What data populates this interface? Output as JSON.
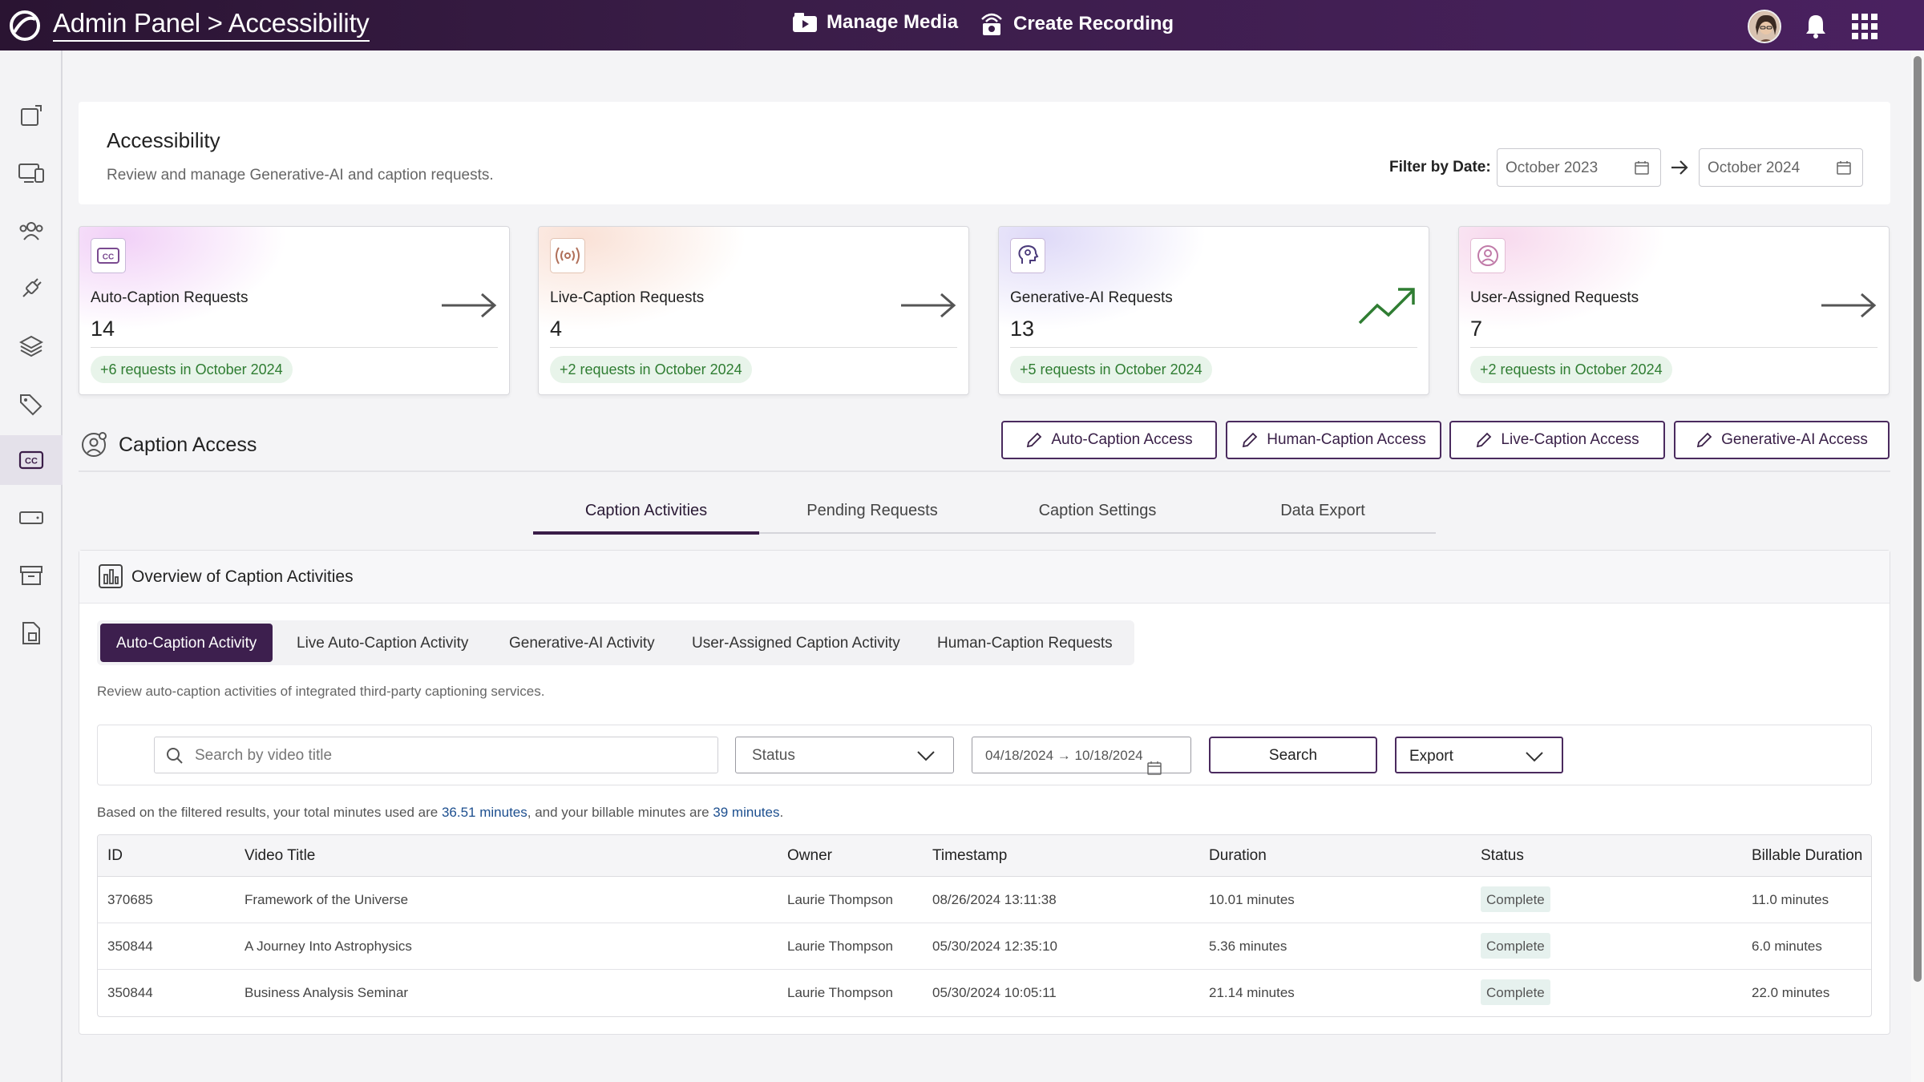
{
  "header": {
    "breadcrumb": "Admin Panel > Accessibility",
    "nav": [
      {
        "label": "Manage Media",
        "icon": "media-icon"
      },
      {
        "label": "Create Recording",
        "icon": "recording-icon"
      }
    ],
    "icons": [
      "avatar",
      "bell-icon",
      "apps-grid-icon"
    ]
  },
  "sidebar": {
    "items": [
      {
        "name": "sidebar-item-dashboard",
        "icon": "dashboard-icon"
      },
      {
        "name": "sidebar-item-devices",
        "icon": "devices-icon"
      },
      {
        "name": "sidebar-item-users",
        "icon": "users-icon"
      },
      {
        "name": "sidebar-item-integrations",
        "icon": "plug-icon"
      },
      {
        "name": "sidebar-item-layers",
        "icon": "layers-icon"
      },
      {
        "name": "sidebar-item-tags",
        "icon": "tags-icon"
      },
      {
        "name": "sidebar-item-accessibility",
        "icon": "closed-caption-icon",
        "active": true
      },
      {
        "name": "sidebar-item-storage",
        "icon": "storage-icon"
      },
      {
        "name": "sidebar-item-archive",
        "icon": "archive-icon"
      },
      {
        "name": "sidebar-item-reports",
        "icon": "report-icon"
      }
    ]
  },
  "page": {
    "title": "Accessibility",
    "subtitle": "Review and manage Generative-AI and caption requests.",
    "filter_label": "Filter by Date:",
    "date_from": "October 2023",
    "date_to": "October 2024"
  },
  "stats": [
    {
      "label": "Auto-Caption Requests",
      "value": "14",
      "delta": "+6 requests in October 2024",
      "icon": "closed-caption-icon"
    },
    {
      "label": "Live-Caption Requests",
      "value": "4",
      "delta": "+2 requests in October 2024",
      "icon": "broadcast-icon"
    },
    {
      "label": "Generative-AI Requests",
      "value": "13",
      "delta": "+5 requests in October 2024",
      "icon": "ai-brain-icon"
    },
    {
      "label": "User-Assigned Requests",
      "value": "7",
      "delta": "+2 requests in October 2024",
      "icon": "user-assigned-icon"
    }
  ],
  "caption_access": {
    "title": "Caption Access",
    "buttons": [
      "Auto-Caption Access",
      "Human-Caption Access",
      "Live-Caption Access",
      "Generative-AI Access"
    ]
  },
  "tabs": [
    "Caption Activities",
    "Pending Requests",
    "Caption Settings",
    "Data Export"
  ],
  "overview": {
    "title": "Overview of Caption Activities",
    "subtabs": [
      "Auto-Caption Activity",
      "Live Auto-Caption Activity",
      "Generative-AI Activity",
      "User-Assigned Caption Activity",
      "Human-Caption Requests"
    ],
    "description": "Review auto-caption activities of integrated third-party captioning services.",
    "search_placeholder": "Search by video title",
    "status_label": "Status",
    "date_range": "04/18/2024 → 10/18/2024",
    "search_button": "Search",
    "export_label": "Export",
    "summary_prefix": "Based on the filtered results, your total minutes used are ",
    "total_minutes": "36.51 minutes",
    "summary_middle": ", and your billable minutes are ",
    "billable_minutes": "39 minutes",
    "summary_suffix": "."
  },
  "table": {
    "columns": [
      "ID",
      "Video Title",
      "Owner",
      "Timestamp",
      "Duration",
      "Status",
      "Billable Duration"
    ],
    "rows": [
      [
        "370685",
        "Framework of the Universe",
        "Laurie Thompson",
        "08/26/2024 13:11:38",
        "10.01 minutes",
        "Complete",
        "11.0 minutes"
      ],
      [
        "350844",
        "A Journey Into Astrophysics",
        "Laurie Thompson",
        "05/30/2024 12:35:10",
        "5.36 minutes",
        "Complete",
        "6.0 minutes"
      ],
      [
        "350844",
        "Business Analysis Seminar",
        "Laurie Thompson",
        "05/30/2024 10:05:11",
        "21.14 minutes",
        "Complete",
        "22.0 minutes"
      ]
    ]
  },
  "colors": {
    "brand": "#3a1d48",
    "accent": "#4a2a5e",
    "positive": "#2f7d32",
    "link": "#1d4f8f"
  }
}
